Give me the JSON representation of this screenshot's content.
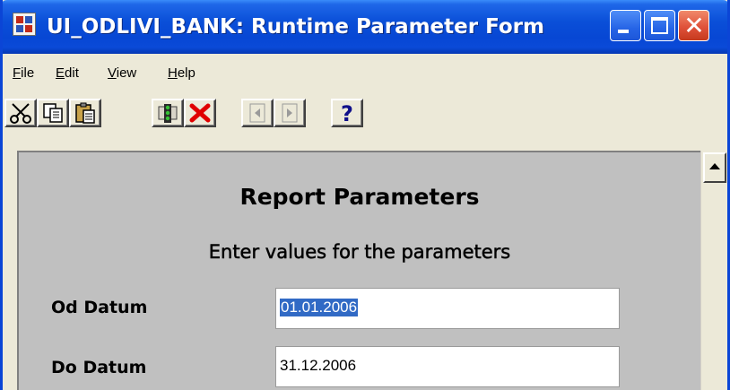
{
  "window": {
    "title": "UI_ODLIVI_BANK: Runtime Parameter Form",
    "icon": "oracle-reports-icon",
    "controls": [
      "minimize-icon",
      "maximize-icon",
      "close-icon"
    ]
  },
  "menu": {
    "items": [
      {
        "underline": "F",
        "rest": "ile"
      },
      {
        "underline": "E",
        "rest": "dit"
      },
      {
        "underline": "V",
        "rest": "iew"
      },
      {
        "underline": "H",
        "rest": "elp"
      }
    ]
  },
  "toolbar": {
    "buttons": [
      {
        "icon": "cut-icon"
      },
      {
        "icon": "copy-icon"
      },
      {
        "icon": "paste-icon"
      },
      {
        "icon": "run-report-icon"
      },
      {
        "icon": "cancel-icon"
      },
      {
        "icon": "previous-page-icon",
        "enabled": false
      },
      {
        "icon": "next-page-icon",
        "enabled": false
      },
      {
        "icon": "help-icon"
      }
    ]
  },
  "form": {
    "title": "Report Parameters",
    "subtitle": "Enter values for the parameters",
    "params": [
      {
        "label": "Od Datum",
        "value": "01.01.2006",
        "selected": true
      },
      {
        "label": "Do Datum",
        "value": "31.12.2006",
        "selected": false
      }
    ]
  },
  "colors": {
    "titlebar": "#0a4fd8",
    "form_background": "#c0c0c0",
    "selection": "#316ac5",
    "cancel_red": "#e00000"
  }
}
